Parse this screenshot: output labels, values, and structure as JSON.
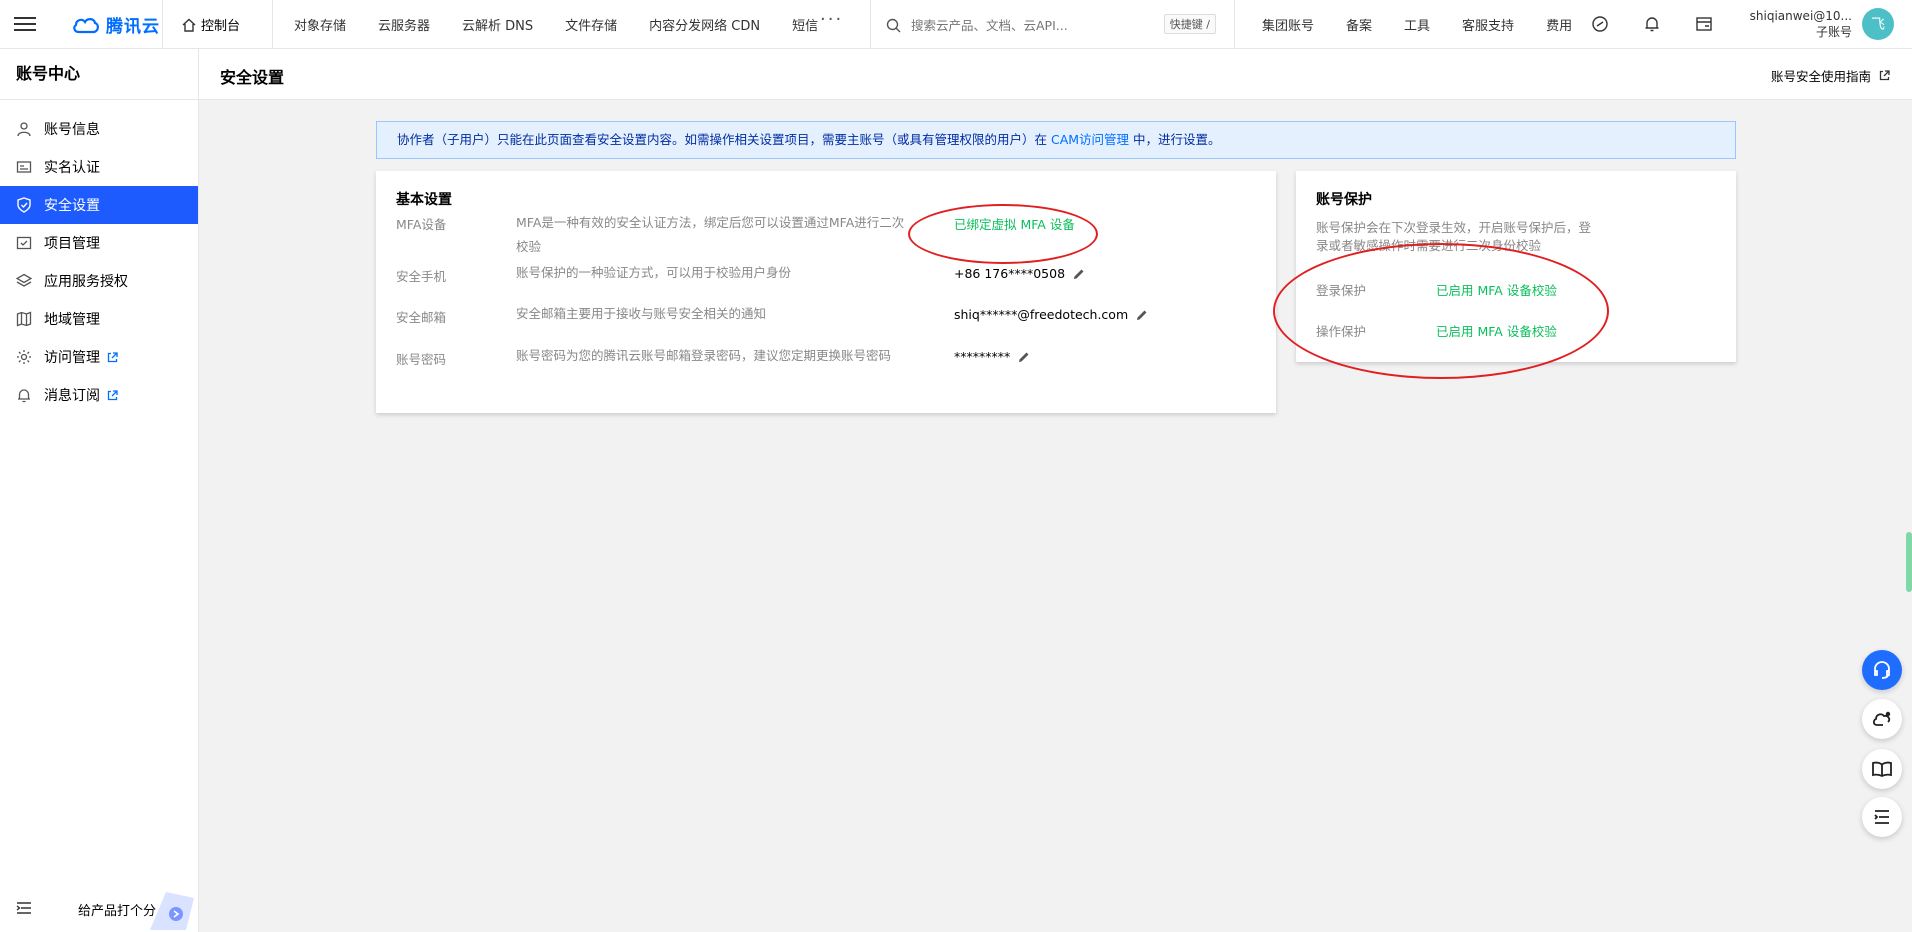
{
  "topbar": {
    "brand": "腾讯云",
    "console": "控制台",
    "nav": [
      "对象存储",
      "云服务器",
      "云解析 DNS",
      "文件存储",
      "内容分发网络 CDN",
      "短信"
    ],
    "more": "···",
    "search_placeholder": "搜索云产品、文档、云API...",
    "shortcut": "快捷键 /",
    "right_nav": [
      "集团账号",
      "备案",
      "工具",
      "客服支持",
      "费用"
    ],
    "username": "shiqianwei@10...",
    "account_type": "子账号",
    "avatar_initial": "飞"
  },
  "sidebar": {
    "title": "账号中心",
    "items": [
      {
        "label": "账号信息"
      },
      {
        "label": "实名认证"
      },
      {
        "label": "安全设置"
      },
      {
        "label": "项目管理"
      },
      {
        "label": "应用服务授权"
      },
      {
        "label": "地域管理"
      },
      {
        "label": "访问管理"
      },
      {
        "label": "消息订阅"
      }
    ],
    "rate_label": "给产品打个分"
  },
  "header": {
    "title": "安全设置",
    "guide": "账号安全使用指南"
  },
  "notice": {
    "before": "协作者（子用户）只能在此页面查看安全设置内容。如需操作相关设置项目，需要主账号（或具有管理权限的用户）在 ",
    "link": "CAM访问管理",
    "after": " 中，进行设置。"
  },
  "basic": {
    "title": "基本设置",
    "rows": [
      {
        "label": "MFA设备",
        "desc": "MFA是一种有效的安全认证方法，绑定后您可以设置通过MFA进行二次校验",
        "value": "已绑定虚拟 MFA 设备"
      },
      {
        "label": "安全手机",
        "desc": "账号保护的一种验证方式，可以用于校验用户身份",
        "value": "+86 176****0508"
      },
      {
        "label": "安全邮箱",
        "desc": "安全邮箱主要用于接收与账号安全相关的通知",
        "value": "shiq******@freedotech.com"
      },
      {
        "label": "账号密码",
        "desc": "账号密码为您的腾讯云账号邮箱登录密码，建议您定期更换账号密码",
        "value": "*********"
      }
    ]
  },
  "protect": {
    "title": "账号保护",
    "desc": "账号保护会在下次登录生效，开启账号保护后，登录或者敏感操作时需要进行二次身份校验",
    "rows": [
      {
        "label": "登录保护",
        "value": "已启用 MFA 设备校验"
      },
      {
        "label": "操作保护",
        "value": "已启用 MFA 设备校验"
      }
    ]
  },
  "colors": {
    "accent": "#1e5bff",
    "success": "#0abf5b",
    "annotation": "#e02020"
  }
}
